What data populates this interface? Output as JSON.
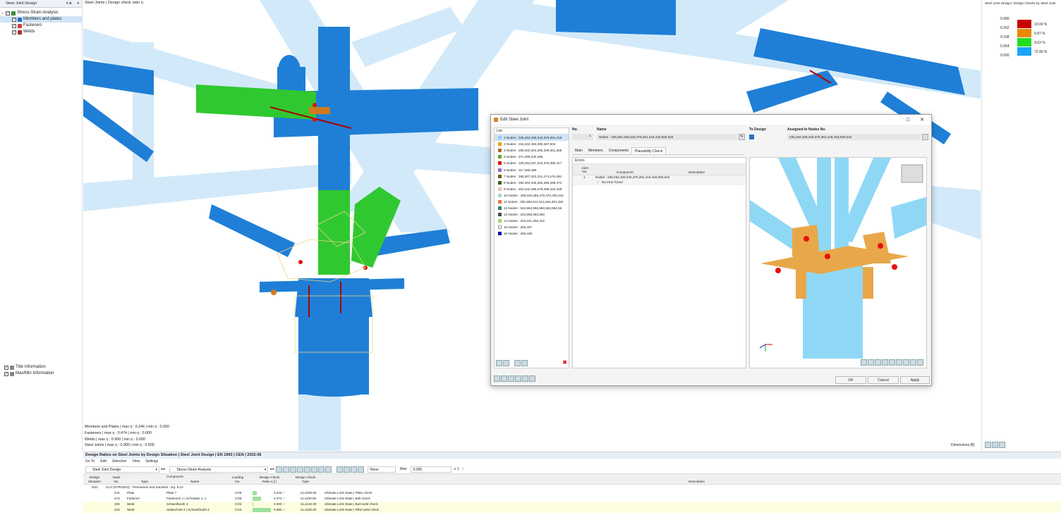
{
  "left_panel": {
    "title": "Steel Joint Design",
    "tree": [
      {
        "label": "Stress-Strain Analysis",
        "level": 0
      },
      {
        "label": "Members and plates",
        "level": 1,
        "selected": true
      },
      {
        "label": "Fasteners",
        "level": 1
      },
      {
        "label": "Welds",
        "level": 1
      }
    ],
    "bottom_items": [
      "Title Information",
      "Max/Min Information"
    ]
  },
  "viewport": {
    "title": "Steel Joints | Design check ratio η",
    "info_lines": [
      "Members and Plates | max η : 0.244 | min η : 0.000",
      "Fasteners | max η : 0.474 | min η : 0.000",
      "Welds | max η : 0.990 | min η : 0.000",
      "Steel Joints | max η : 0.990 | min η : 0.000"
    ],
    "dimensions_label": "Dimensions [ft]"
  },
  "right_panel": {
    "title": "Steel Joint Design | Design Checks by Steel Joint",
    "legend": [
      {
        "value": "0.990",
        "color": "#c80000",
        "pct": "10.00 %"
      },
      {
        "value": "0.262",
        "color": "#e88a00",
        "pct": "6.87 %"
      },
      {
        "value": "0.158",
        "color": "#22dd22",
        "pct": "9.63 %"
      },
      {
        "value": "0.054",
        "color": "#1aa3ff",
        "pct": "72.90 %"
      },
      {
        "value": "0.000",
        "color": "",
        "pct": ""
      }
    ]
  },
  "dialog": {
    "title": "Edit Steel Joint",
    "list_header": "List",
    "list": [
      {
        "label": "1  Nodes : 236,254,328,343,376,391,418",
        "color": "#9ad0f5"
      },
      {
        "label": "2  Nodes : 315,332,383,380,467,504",
        "color": "#e8a000"
      },
      {
        "label": "3  Nodes : 296,300,304,305,349,351,355",
        "color": "#b06a30"
      },
      {
        "label": "4  Nodes : 271,298,430,465",
        "color": "#6aa52a"
      },
      {
        "label": "5  Nodes : 229,253,327,342,375,390,417",
        "color": "#e01010"
      },
      {
        "label": "6  Nodes : 317,365,489",
        "color": "#8a6fd0"
      },
      {
        "label": "7  Nodes : 265,307,310,311,474,476,482",
        "color": "#7a5a20"
      },
      {
        "label": "8  Nodes : 294,303,346,352,396,399,472",
        "color": "#3a5a20"
      },
      {
        "label": "9  Nodes : 204,242,259,278,406,423,438",
        "color": "#e8c8a0"
      },
      {
        "label": "10  Nodes : 339,346,355,279,470,425,442",
        "color": "#a0d8d8"
      },
      {
        "label": "11  Nodes : 300,309,312,313,483,481,484",
        "color": "#e87a40"
      },
      {
        "label": "12  Nodes : 542,553,556,560,562,584,56",
        "color": "#2a8a70"
      },
      {
        "label": "13  Nodes : 334,555,592,583",
        "color": "#4a4a4a"
      },
      {
        "label": "14  Nodes : 202,241,405,422",
        "color": "#a8d060"
      },
      {
        "label": "15  Nodes : 206,407",
        "color": "#ffffff"
      },
      {
        "label": "16  Nodes : 260,439",
        "color": "#1010a0"
      }
    ],
    "no_label": "No.",
    "no_value": "1",
    "name_label": "Name",
    "name_value": "Nodes : 236,254,328,343,376,391,418,433,500,515",
    "to_design_label": "To Design",
    "assigned_label": "Assigned to Nodes No.",
    "assigned_value": "236,254,328,343,376,391,418,433,500,515",
    "tabs": [
      "Main",
      "Members",
      "Components",
      "Plausibility Check"
    ],
    "active_tab": 3,
    "errors_title": "Errors",
    "errors_headers": {
      "joint_no": "Joint No.",
      "component": "Component",
      "description": "Description"
    },
    "errors_row_joint": "1",
    "errors_row_nodes": "Nodes : 236,254,328,343,376,391,418,433,500,515",
    "errors_row_msg": "No error found",
    "ok": "OK",
    "cancel": "Cancel",
    "apply": "Apply"
  },
  "bottom": {
    "title": "Design Ratios on Steel Joints by Design Situation | Steel Joint Design | EN 1993 | CEN | 2015-06",
    "menu": [
      "Go To",
      "Edit",
      "Selection",
      "View",
      "Settings"
    ],
    "combo1": "Steel Joint Design",
    "combo2": "Stress-Strain Analysis",
    "combo3": "None",
    "max_label": "Max:",
    "max_value": "0.990",
    "max_suffix": "≤ 1",
    "headers": {
      "design_situation": "Design Situation",
      "node_no": "Node No.",
      "component": "Component",
      "type": "Type",
      "name": "Name",
      "loading": "Loading No.",
      "ratio": "Design Check Ratio η [-]",
      "check_type": "Design Check Type",
      "description": "Description"
    },
    "group_situation": "DS1",
    "group_label": "ULS (STR/GEO) - Permanent and transient - Eq. 6.10",
    "rows": [
      {
        "node": "241",
        "type": "Plate",
        "name": "Plate 7",
        "loading": "CO6",
        "ratio": "0.244",
        "check": "UL1000.00",
        "desc": "Ultimate Limit State | Plate check"
      },
      {
        "node": "473",
        "type": "Fastener",
        "name": "Fasteners 1 | Schraube 2, 1",
        "loading": "CO6",
        "ratio": "0.474",
        "check": "UL1100.00",
        "desc": "Ultimate Limit State | Bolt check"
      },
      {
        "node": "236",
        "type": "Weld",
        "name": "Schweißnaht 4",
        "loading": "CO4",
        "ratio": "0.000",
        "check": "UL1210.00",
        "desc": "Ultimate Limit State | Butt weld check"
      },
      {
        "node": "433",
        "type": "Weld",
        "name": "Stabschnitt 2 | Schweißnaht 4",
        "loading": "CO4",
        "ratio": "0.990",
        "check": "UL1200.00",
        "desc": "Ultimate Limit State | Fillet weld check"
      }
    ]
  }
}
